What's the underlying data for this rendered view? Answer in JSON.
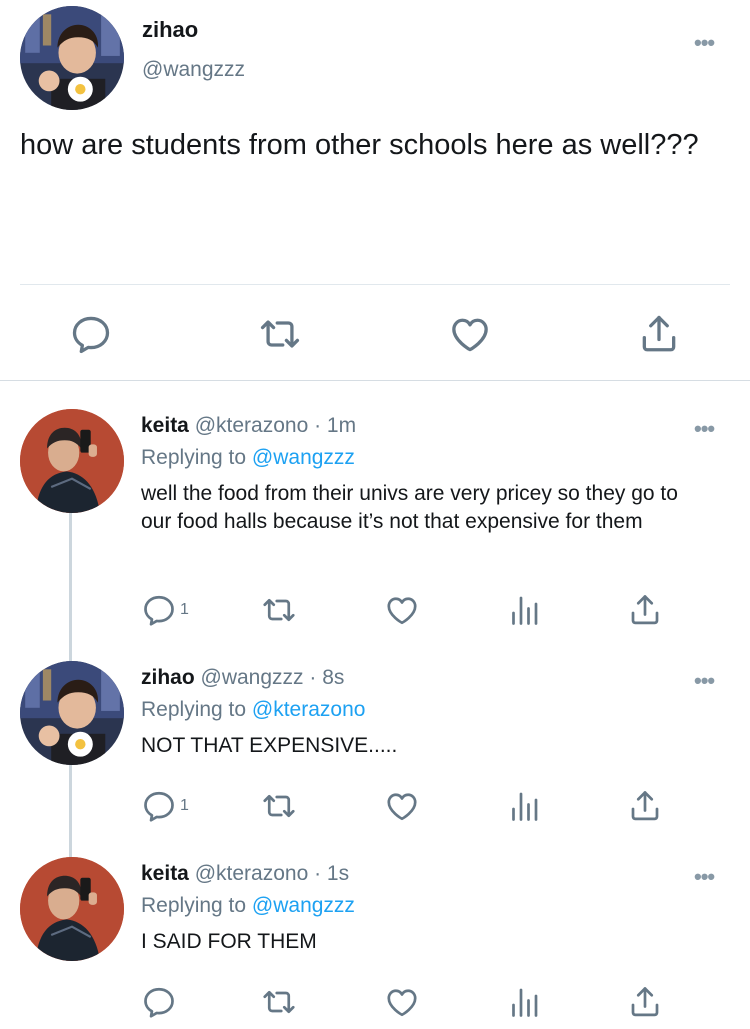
{
  "main_tweet": {
    "name": "zihao",
    "handle": "@wangzzz",
    "text": "how are students from other schools here as well???",
    "more_label": "•••"
  },
  "replies": [
    {
      "name": "keita",
      "handle": "@kterazono",
      "time": "· 1m",
      "replying_prefix": "Replying to",
      "replying_to": "@wangzzz",
      "text": "well the food from their univs are very pricey so they go to our food halls because it’s not that expensive for them",
      "reply_count": "1",
      "more_label": "•••"
    },
    {
      "name": "zihao",
      "handle": "@wangzzz",
      "time": "· 8s",
      "replying_prefix": "Replying to",
      "replying_to": "@kterazono",
      "text": "NOT THAT EXPENSIVE.....",
      "reply_count": "1",
      "more_label": "•••"
    },
    {
      "name": "keita",
      "handle": "@kterazono",
      "time": "· 1s",
      "replying_prefix": "Replying to",
      "replying_to": "@wangzzz",
      "text": "I SAID FOR THEM",
      "reply_count": "",
      "more_label": "•••"
    }
  ],
  "icons": [
    "reply-icon",
    "retweet-icon",
    "like-icon",
    "analytics-icon",
    "share-icon",
    "more-icon"
  ],
  "colors": {
    "link": "#1da1f2",
    "muted": "#657786",
    "icon": "#657786",
    "text": "#14171a"
  }
}
